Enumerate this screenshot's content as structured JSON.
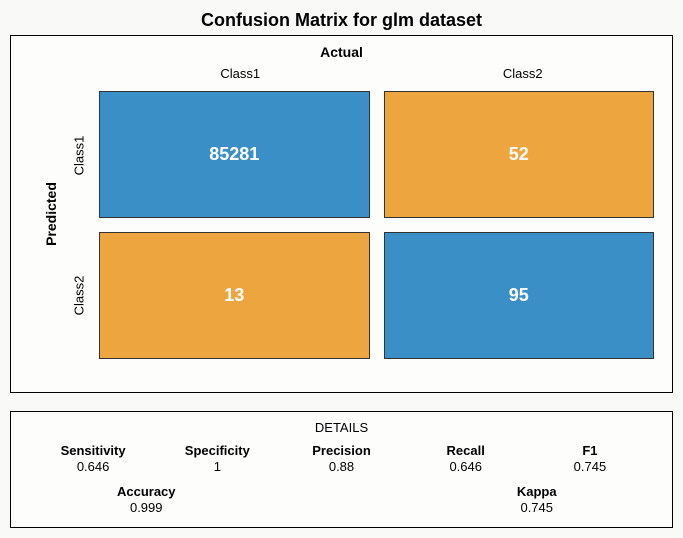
{
  "title": "Confusion Matrix for glm dataset",
  "axes": {
    "actual": "Actual",
    "predicted": "Predicted",
    "col1": "Class1",
    "col2": "Class2",
    "row1": "Class1",
    "row2": "Class2"
  },
  "cells": {
    "tl": "85281",
    "tr": "52",
    "bl": "13",
    "br": "95"
  },
  "colors": {
    "diag": "#3a8fc6",
    "off": "#eda63f"
  },
  "details": {
    "heading": "DETAILS",
    "row1": {
      "sensitivity": {
        "label": "Sensitivity",
        "value": "0.646"
      },
      "specificity": {
        "label": "Specificity",
        "value": "1"
      },
      "precision": {
        "label": "Precision",
        "value": "0.88"
      },
      "recall": {
        "label": "Recall",
        "value": "0.646"
      },
      "f1": {
        "label": "F1",
        "value": "0.745"
      }
    },
    "row2": {
      "accuracy": {
        "label": "Accuracy",
        "value": "0.999"
      },
      "kappa": {
        "label": "Kappa",
        "value": "0.745"
      }
    }
  },
  "chart_data": {
    "type": "heatmap",
    "title": "Confusion Matrix for glm dataset",
    "xlabel": "Actual",
    "ylabel": "Predicted",
    "categories_x": [
      "Class1",
      "Class2"
    ],
    "categories_y": [
      "Class1",
      "Class2"
    ],
    "matrix": [
      [
        85281,
        52
      ],
      [
        13,
        95
      ]
    ],
    "metrics": {
      "Sensitivity": 0.646,
      "Specificity": 1,
      "Precision": 0.88,
      "Recall": 0.646,
      "F1": 0.745,
      "Accuracy": 0.999,
      "Kappa": 0.745
    }
  }
}
